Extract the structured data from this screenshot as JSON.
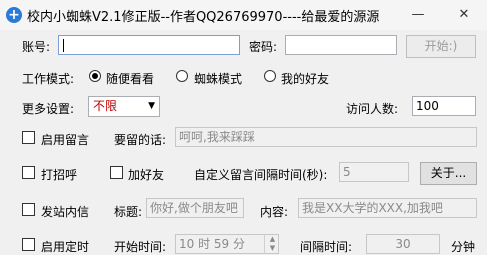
{
  "window": {
    "title": "校内小蜘蛛V2.1修正版--作者QQ26769970----给最爱的源源",
    "minimize": "—",
    "close": "✕"
  },
  "login": {
    "account_label": "账号:",
    "account_value": "",
    "password_label": "密码:",
    "password_value": "",
    "start_button": "开始:)"
  },
  "mode": {
    "label": "工作模式:",
    "options": [
      "随便看看",
      "蜘蛛模式",
      "我的好友"
    ],
    "selected": "随便看看"
  },
  "more": {
    "label": "更多设置:",
    "select_value": "不限",
    "visitors_label": "访问人数:",
    "visitors_value": "100"
  },
  "message": {
    "enable_label": "启用留言",
    "text_label": "要留的话:",
    "text_value": "呵呵,我来踩踩"
  },
  "greet": {
    "greet_label": "打招呼",
    "add_friend_label": "加好友",
    "interval_label": "自定义留言间隔时间(秒):",
    "interval_value": "5",
    "about_button": "关于..."
  },
  "mail": {
    "label": "发站内信",
    "subject_label": "标题:",
    "subject_value": "你好,做个朋友吧",
    "content_label": "内容:",
    "content_value": "我是XX大学的XXX,加我吧"
  },
  "timer": {
    "label": "启用定时",
    "start_label": "开始时间:",
    "start_value": "10 时 59 分",
    "interval_label": "间隔时间:",
    "interval_value": "30",
    "unit": "分钟"
  },
  "colors": {
    "accent": "#2a7ad8",
    "select_text": "#c00000"
  }
}
